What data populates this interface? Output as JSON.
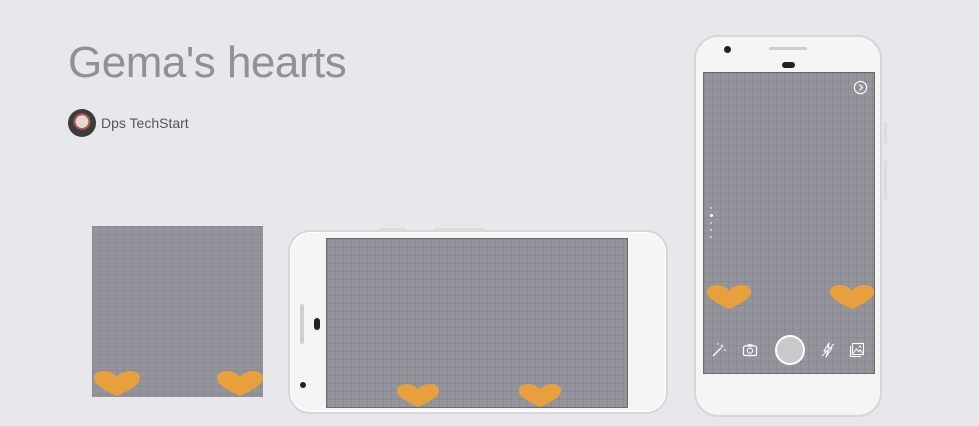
{
  "page": {
    "title": "Gema's hearts",
    "author": "Dps TechStart"
  },
  "icons": {
    "avatar": "avatar-image",
    "heart": "heart-icon",
    "next": "circle-chevron-right-icon",
    "toolbar": [
      "magic-wand-icon",
      "switch-camera-icon",
      "shutter-button",
      "flash-icon",
      "gallery-icon"
    ]
  },
  "colors": {
    "background": "#e8e8ec",
    "screen": "#94959c",
    "heart": "#e8a03c"
  }
}
